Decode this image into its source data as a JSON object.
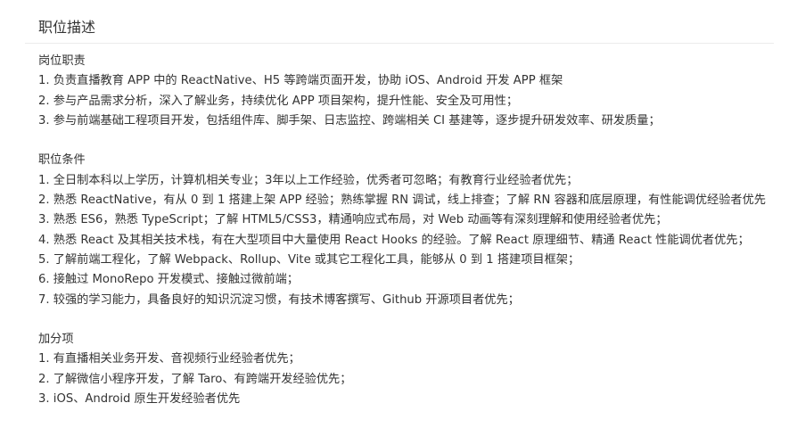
{
  "section": {
    "title": "职位描述"
  },
  "groups": [
    {
      "title": "岗位职责",
      "items": [
        "1. 负责直播教育 APP 中的 ReactNative、H5 等跨端页面开发，协助 iOS、Android 开发 APP 框架",
        "2. 参与产品需求分析，深入了解业务，持续优化 APP 项目架构，提升性能、安全及可用性；",
        "3. 参与前端基础工程项目开发，包括组件库、脚手架、日志监控、跨端相关 CI 基建等，逐步提升研发效率、研发质量；"
      ]
    },
    {
      "title": "职位条件",
      "items": [
        "1. 全日制本科以上学历，计算机相关专业；3年以上工作经验，优秀者可忽略；有教育行业经验者优先；",
        "2. 熟悉 ReactNative，有从 0 到 1 搭建上架 APP 经验；熟练掌握 RN 调试，线上排查；了解 RN 容器和底层原理，有性能调优经验者优先",
        "3. 熟悉 ES6，熟悉 TypeScript；了解 HTML5/CSS3，精通响应式布局，对 Web 动画等有深刻理解和使用经验者优先；",
        "4. 熟悉 React 及其相关技术栈，有在大型项目中大量使用 React Hooks 的经验。了解 React 原理细节、精通 React 性能调优者优先；",
        "5. 了解前端工程化，了解 Webpack、Rollup、Vite 或其它工程化工具，能够从 0 到 1 搭建项目框架；",
        "6. 接触过 MonoRepo 开发模式、接触过微前端；",
        "7. 较强的学习能力，具备良好的知识沉淀习惯，有技术博客撰写、Github 开源项目者优先；"
      ]
    },
    {
      "title": "加分项",
      "items": [
        "1. 有直播相关业务开发、音视频行业经验者优先；",
        "2. 了解微信小程序开发，了解 Taro、有跨端开发经验优先；",
        "3. iOS、Android 原生开发经验者优先"
      ]
    }
  ]
}
